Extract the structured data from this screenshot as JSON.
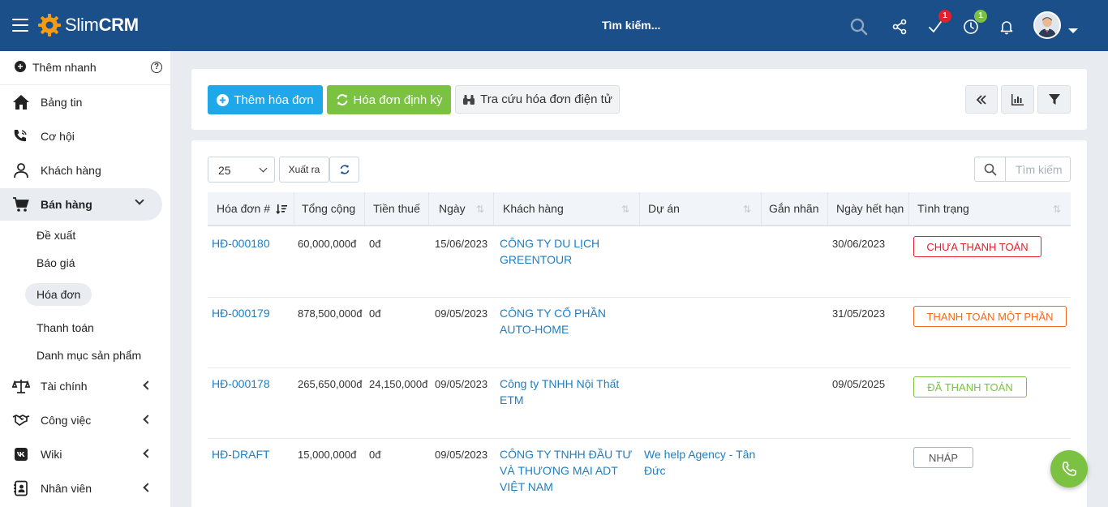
{
  "app": {
    "logo_slim": "Slim",
    "logo_crm": "CRM"
  },
  "topbar": {
    "search_placeholder": "Tìm kiếm...",
    "tasks_badge": "1",
    "timer_badge": "1"
  },
  "sidebar": {
    "quick_add": "Thêm nhanh",
    "items": [
      {
        "label": "Bảng tin"
      },
      {
        "label": "Cơ hội"
      },
      {
        "label": "Khách hàng"
      },
      {
        "label": "Bán hàng"
      },
      {
        "label": "Tài chính"
      },
      {
        "label": "Công việc"
      },
      {
        "label": "Wiki"
      },
      {
        "label": "Nhân viên"
      }
    ],
    "sales_sub": [
      {
        "label": "Đề xuất"
      },
      {
        "label": "Báo giá"
      },
      {
        "label": "Hóa đơn"
      },
      {
        "label": "Thanh toán"
      },
      {
        "label": "Danh mục sản phẩm"
      }
    ]
  },
  "toolbar": {
    "add_invoice": "Thêm hóa đơn",
    "recurring": "Hóa đơn định kỳ",
    "lookup": "Tra cứu hóa đơn điện tử"
  },
  "table_controls": {
    "page_length": "25",
    "export": "Xuất ra",
    "search_placeholder": "Tìm kiếm"
  },
  "table": {
    "headers": {
      "invoice": "Hóa đơn #",
      "total": "Tổng cộng",
      "tax": "Tiền thuế",
      "date": "Ngày",
      "customer": "Khách hàng",
      "project": "Dự án",
      "tags": "Gắn nhãn",
      "due": "Ngày hết hạn",
      "status": "Tình trạng"
    },
    "rows": [
      {
        "invoice": "HĐ-000180",
        "total": "60,000,000đ",
        "tax": "0đ",
        "date": "15/06/2023",
        "customer": "CÔNG TY DU LỊCH GREENTOUR",
        "project": "",
        "tags": "",
        "due": "30/06/2023",
        "status": "CHƯA THANH TOÁN"
      },
      {
        "invoice": "HĐ-000179",
        "total": "878,500,000đ",
        "tax": "0đ",
        "date": "09/05/2023",
        "customer": "CÔNG TY CỔ PHẦN AUTO-HOME",
        "project": "",
        "tags": "",
        "due": "31/05/2023",
        "status": "THANH TOÁN MỘT PHẦN"
      },
      {
        "invoice": "HĐ-000178",
        "total": "265,650,000đ",
        "tax": "24,150,000đ",
        "date": "09/05/2023",
        "customer": "Công ty TNHH Nội Thất ETM",
        "project": "",
        "tags": "",
        "due": "09/05/2025",
        "status": "ĐÃ THANH TOÁN"
      },
      {
        "invoice": "HĐ-DRAFT",
        "total": "15,000,000đ",
        "tax": "0đ",
        "date": "09/05/2023",
        "customer": "CÔNG TY TNHH ĐẦU TƯ VÀ THƯƠNG MẠI ADT VIỆT NAM",
        "project": "We help Agency - Tân Đức",
        "tags": "",
        "due": "",
        "status": "NHÁP"
      }
    ]
  },
  "colors": {
    "header": "#1b4f8a",
    "primary": "#1fa8e9",
    "success": "#7cc242",
    "unpaid": "#e0202a",
    "partial": "#f06a1c",
    "paid": "#7cc242",
    "draft": "#8a939c",
    "link": "#1f7ec1"
  }
}
